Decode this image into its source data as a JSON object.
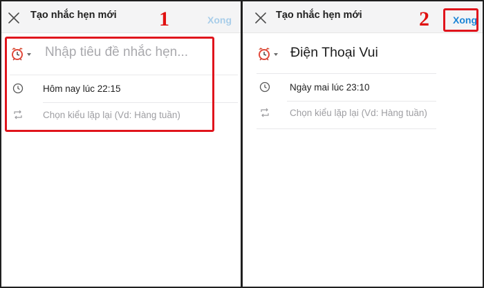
{
  "panels": [
    {
      "step": "1",
      "header": {
        "title": "Tạo nhắc hẹn mới",
        "done_label": "Xong"
      },
      "title_field": {
        "placeholder": "Nhập tiêu đề nhắc hẹn..."
      },
      "time_text": "Hôm nay lúc 22:15",
      "repeat_text": "Chọn kiểu lặp lại (Vd: Hàng tuần)"
    },
    {
      "step": "2",
      "header": {
        "title": "Tạo nhắc hẹn mới",
        "done_label": "Xong"
      },
      "title_field": {
        "value": "Điện Thoại Vui"
      },
      "time_text": "Ngày mai lúc 23:10",
      "repeat_text": "Chọn kiểu lặp lại (Vd: Hàng tuần)"
    }
  ],
  "colors": {
    "highlight": "#e0141c",
    "step_number": "#e01010",
    "done_active": "#1a84d6",
    "done_inactive": "#a8cde9",
    "header_bg": "#f4f4f5"
  },
  "icons": {
    "close": "close-icon",
    "alarm": "alarm-clock-icon",
    "dropdown": "caret-down-icon",
    "time": "clock-icon",
    "repeat": "repeat-icon"
  }
}
